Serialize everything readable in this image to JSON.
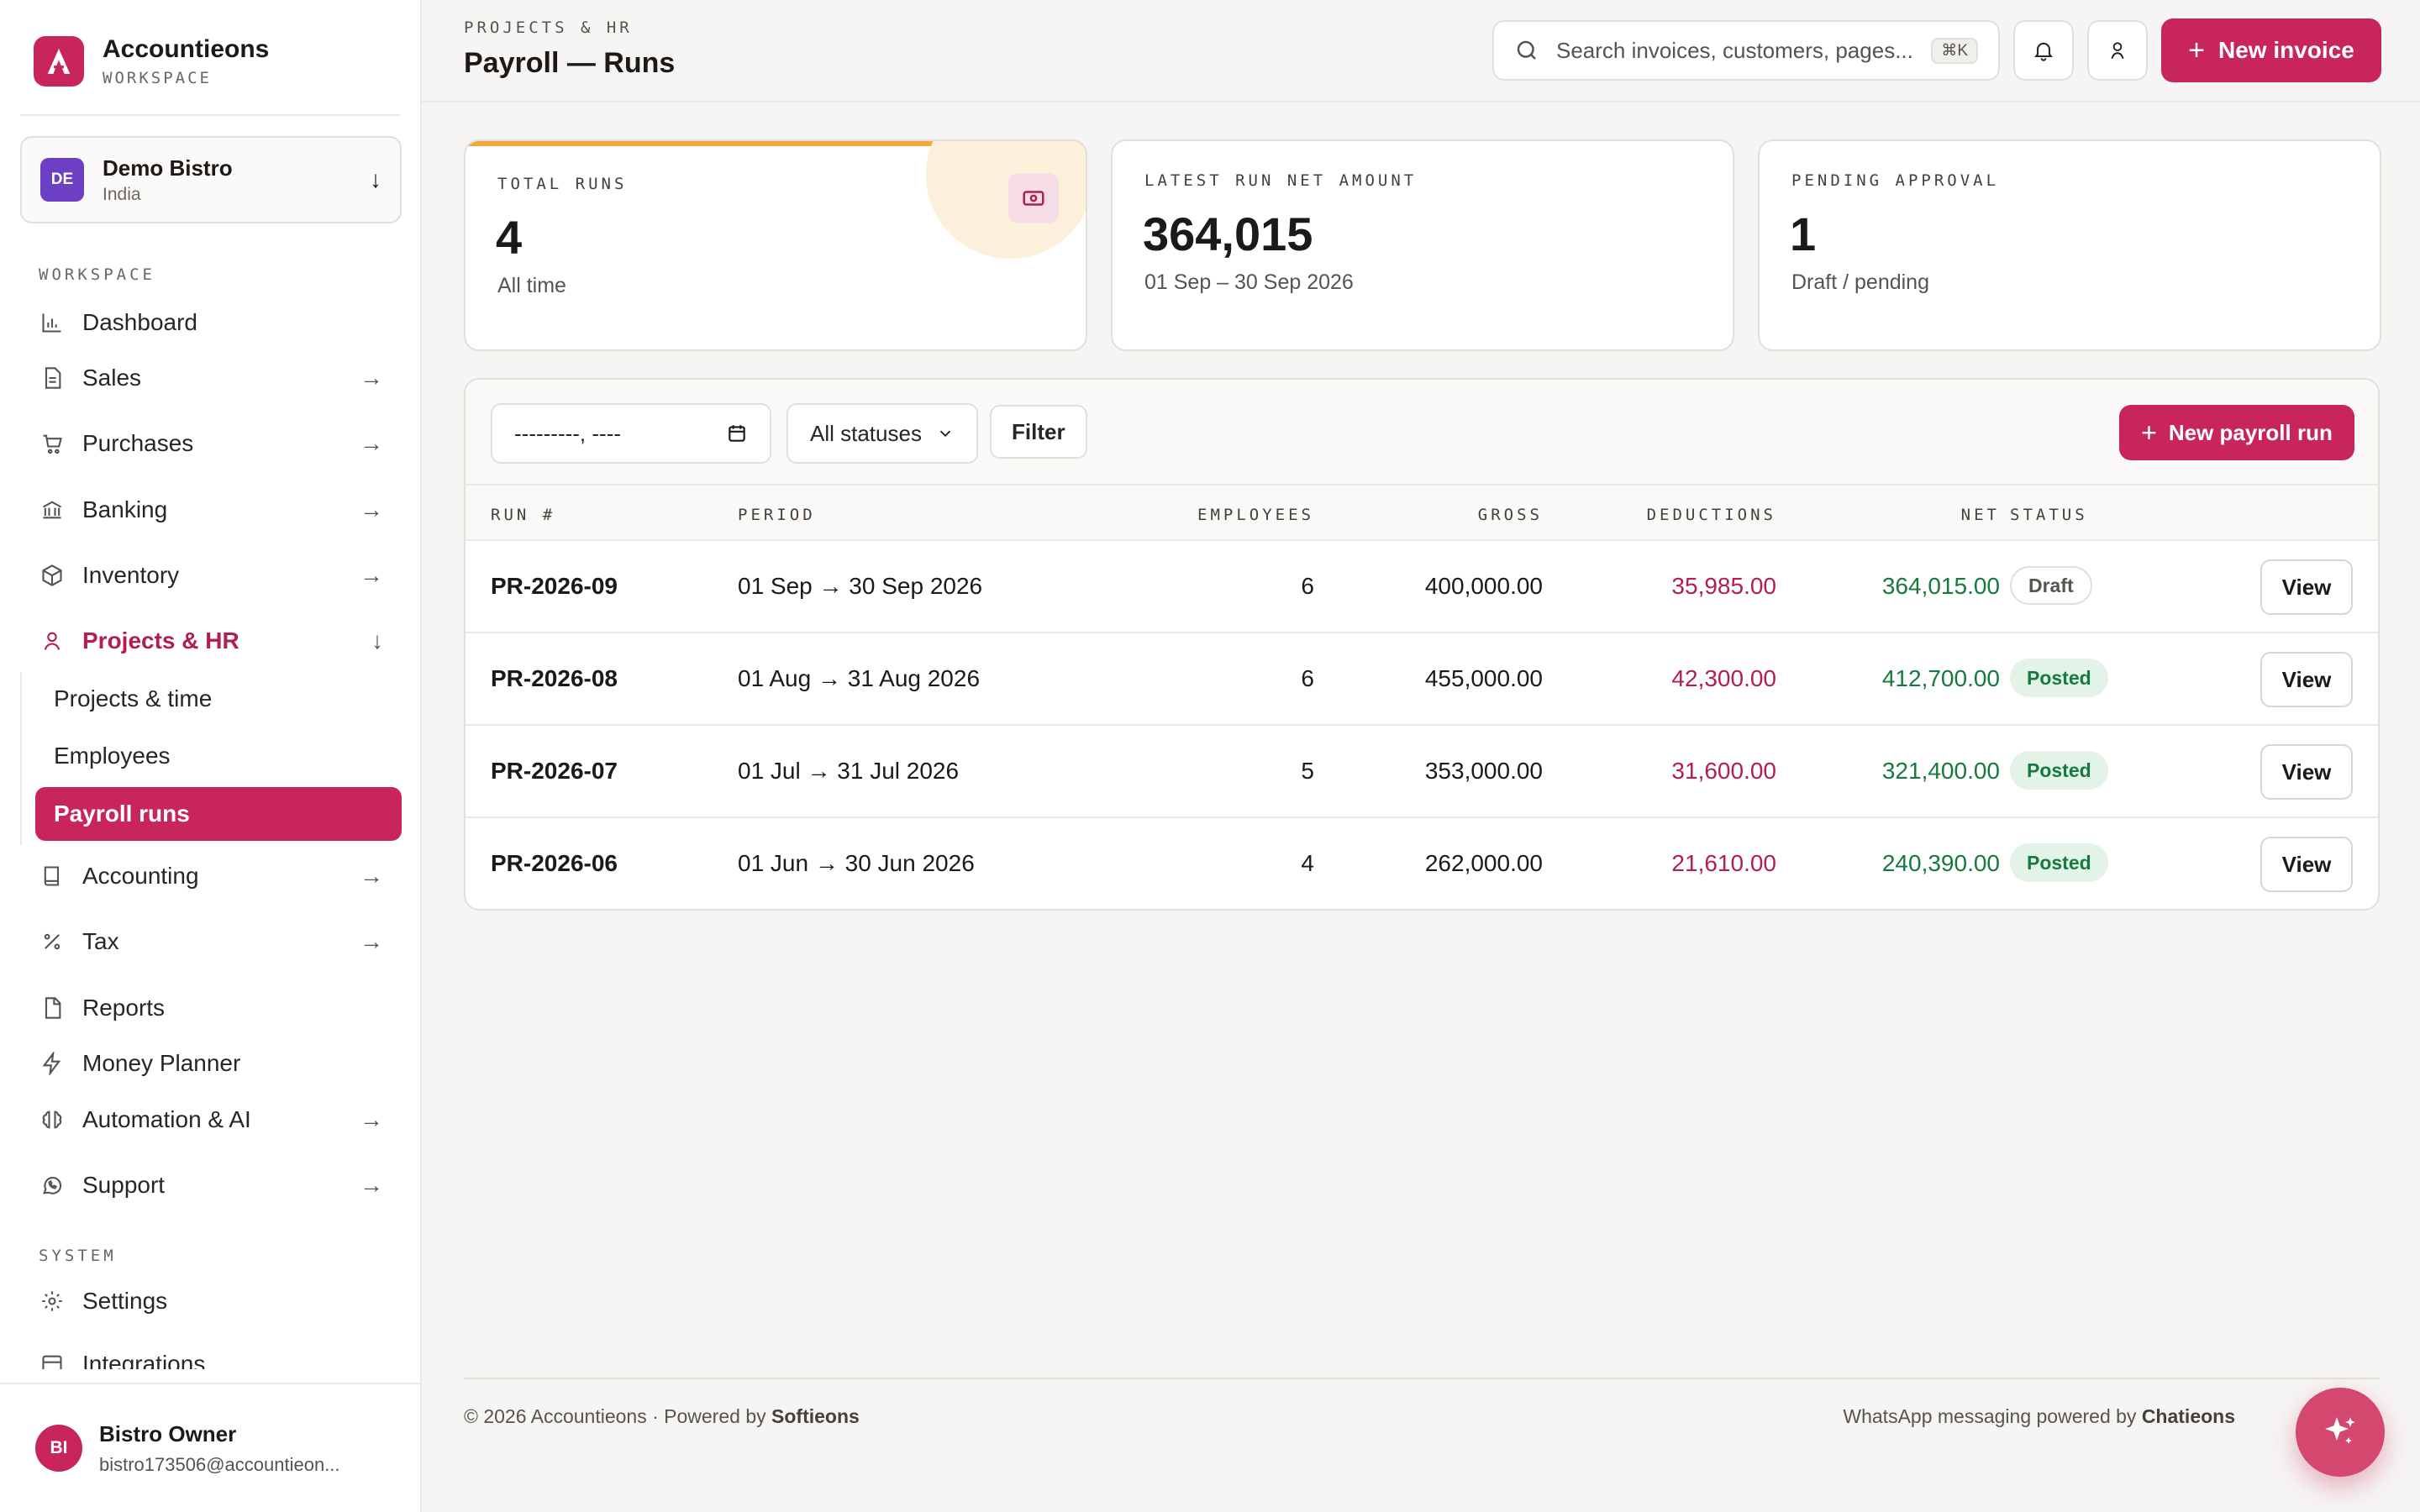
{
  "app": {
    "name": "Accountieons",
    "workspace_label": "WORKSPACE",
    "brand_color": "#c8265a"
  },
  "org": {
    "initials": "DE",
    "name": "Demo Bistro",
    "country": "India"
  },
  "nav": {
    "workspace_label": "WORKSPACE",
    "system_label": "SYSTEM",
    "items": {
      "dashboard": "Dashboard",
      "sales": "Sales",
      "purchases": "Purchases",
      "banking": "Banking",
      "inventory": "Inventory",
      "projects_hr": "Projects & HR",
      "accounting": "Accounting",
      "tax": "Tax",
      "reports": "Reports",
      "money_planner": "Money Planner",
      "automation_ai": "Automation & AI",
      "support": "Support",
      "settings": "Settings",
      "integrations": "Integrations"
    },
    "sub_items": {
      "projects_time": "Projects & time",
      "employees": "Employees",
      "payroll_runs": "Payroll runs"
    }
  },
  "user": {
    "initials": "BI",
    "name": "Bistro Owner",
    "email": "bistro173506@accountieon..."
  },
  "header": {
    "breadcrumb": "PROJECTS & HR",
    "title": "Payroll — Runs",
    "search_placeholder": "Search invoices, customers, pages...",
    "search_shortcut": "⌘K",
    "new_invoice_label": "New invoice"
  },
  "stats": {
    "total_runs": {
      "label": "TOTAL RUNS",
      "value": "4",
      "note": "All time"
    },
    "latest_net": {
      "label": "LATEST RUN NET AMOUNT",
      "value": "364,015",
      "note": "01 Sep – 30 Sep 2026"
    },
    "pending": {
      "label": "PENDING APPROVAL",
      "value": "1",
      "note": "Draft / pending"
    }
  },
  "filters": {
    "month_value": "---------, ----",
    "status_options": [
      "All statuses"
    ],
    "status_selected": "All statuses",
    "filter_label": "Filter",
    "new_run_label": "New payroll run"
  },
  "table": {
    "columns": {
      "run": "RUN #",
      "period": "PERIOD",
      "employees": "EMPLOYEES",
      "gross": "GROSS",
      "deductions": "DEDUCTIONS",
      "net": "NET",
      "status": "STATUS"
    },
    "view_label": "View",
    "rows": [
      {
        "run": "PR-2026-09",
        "period": "01 Sep → 30 Sep 2026",
        "employees": "6",
        "gross": "400,000.00",
        "deductions": "35,985.00",
        "net": "364,015.00",
        "status": "Draft"
      },
      {
        "run": "PR-2026-08",
        "period": "01 Aug → 31 Aug 2026",
        "employees": "6",
        "gross": "455,000.00",
        "deductions": "42,300.00",
        "net": "412,700.00",
        "status": "Posted"
      },
      {
        "run": "PR-2026-07",
        "period": "01 Jul → 31 Jul 2026",
        "employees": "5",
        "gross": "353,000.00",
        "deductions": "31,600.00",
        "net": "321,400.00",
        "status": "Posted"
      },
      {
        "run": "PR-2026-06",
        "period": "01 Jun → 30 Jun 2026",
        "employees": "4",
        "gross": "262,000.00",
        "deductions": "21,610.00",
        "net": "240,390.00",
        "status": "Posted"
      }
    ]
  },
  "footer": {
    "copyright": "© 2026 Accountieons · Powered by ",
    "copyright_brand": "Softieons",
    "whatsapp": "WhatsApp messaging powered by ",
    "whatsapp_brand": "Chatieons"
  }
}
